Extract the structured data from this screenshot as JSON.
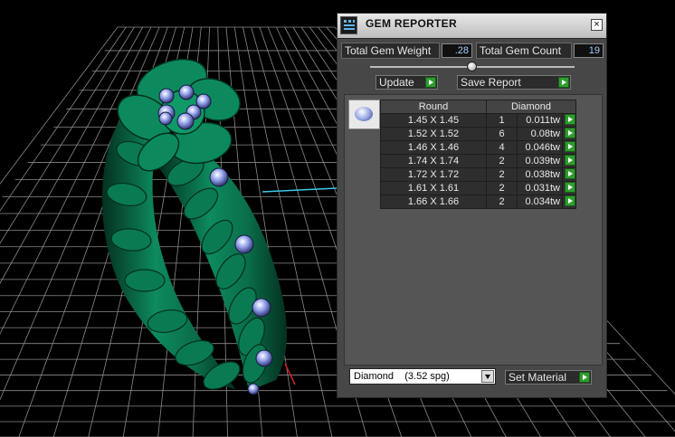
{
  "window": {
    "title": "GEM REPORTER",
    "close_glyph": "×"
  },
  "summary": {
    "weight_label": "Total Gem Weight",
    "weight_value": ".28",
    "count_label": "Total Gem Count",
    "count_value": "19"
  },
  "actions": {
    "update_label": "Update",
    "save_label": "Save Report",
    "set_material_label": "Set Material"
  },
  "table": {
    "headers": [
      "Round",
      "Diamond"
    ],
    "rows": [
      {
        "size": "1.45 X 1.45",
        "qty": "1",
        "tw": "0.011tw"
      },
      {
        "size": "1.52 X 1.52",
        "qty": "6",
        "tw": "0.08tw"
      },
      {
        "size": "1.46 X 1.46",
        "qty": "4",
        "tw": "0.046tw"
      },
      {
        "size": "1.74 X 1.74",
        "qty": "2",
        "tw": "0.039tw"
      },
      {
        "size": "1.72 X 1.72",
        "qty": "2",
        "tw": "0.038tw"
      },
      {
        "size": "1.61 X 1.61",
        "qty": "2",
        "tw": "0.031tw"
      },
      {
        "size": "1.66 X 1.66",
        "qty": "2",
        "tw": "0.034tw"
      }
    ]
  },
  "material": {
    "selected": "Diamond    (3.52 spg)"
  },
  "colors": {
    "ring": "#0b7a55",
    "ring_dark": "#04422e",
    "grid": "#8a8a8a",
    "gem": "#8f9ee8",
    "go_button": "#2f9d2f"
  }
}
